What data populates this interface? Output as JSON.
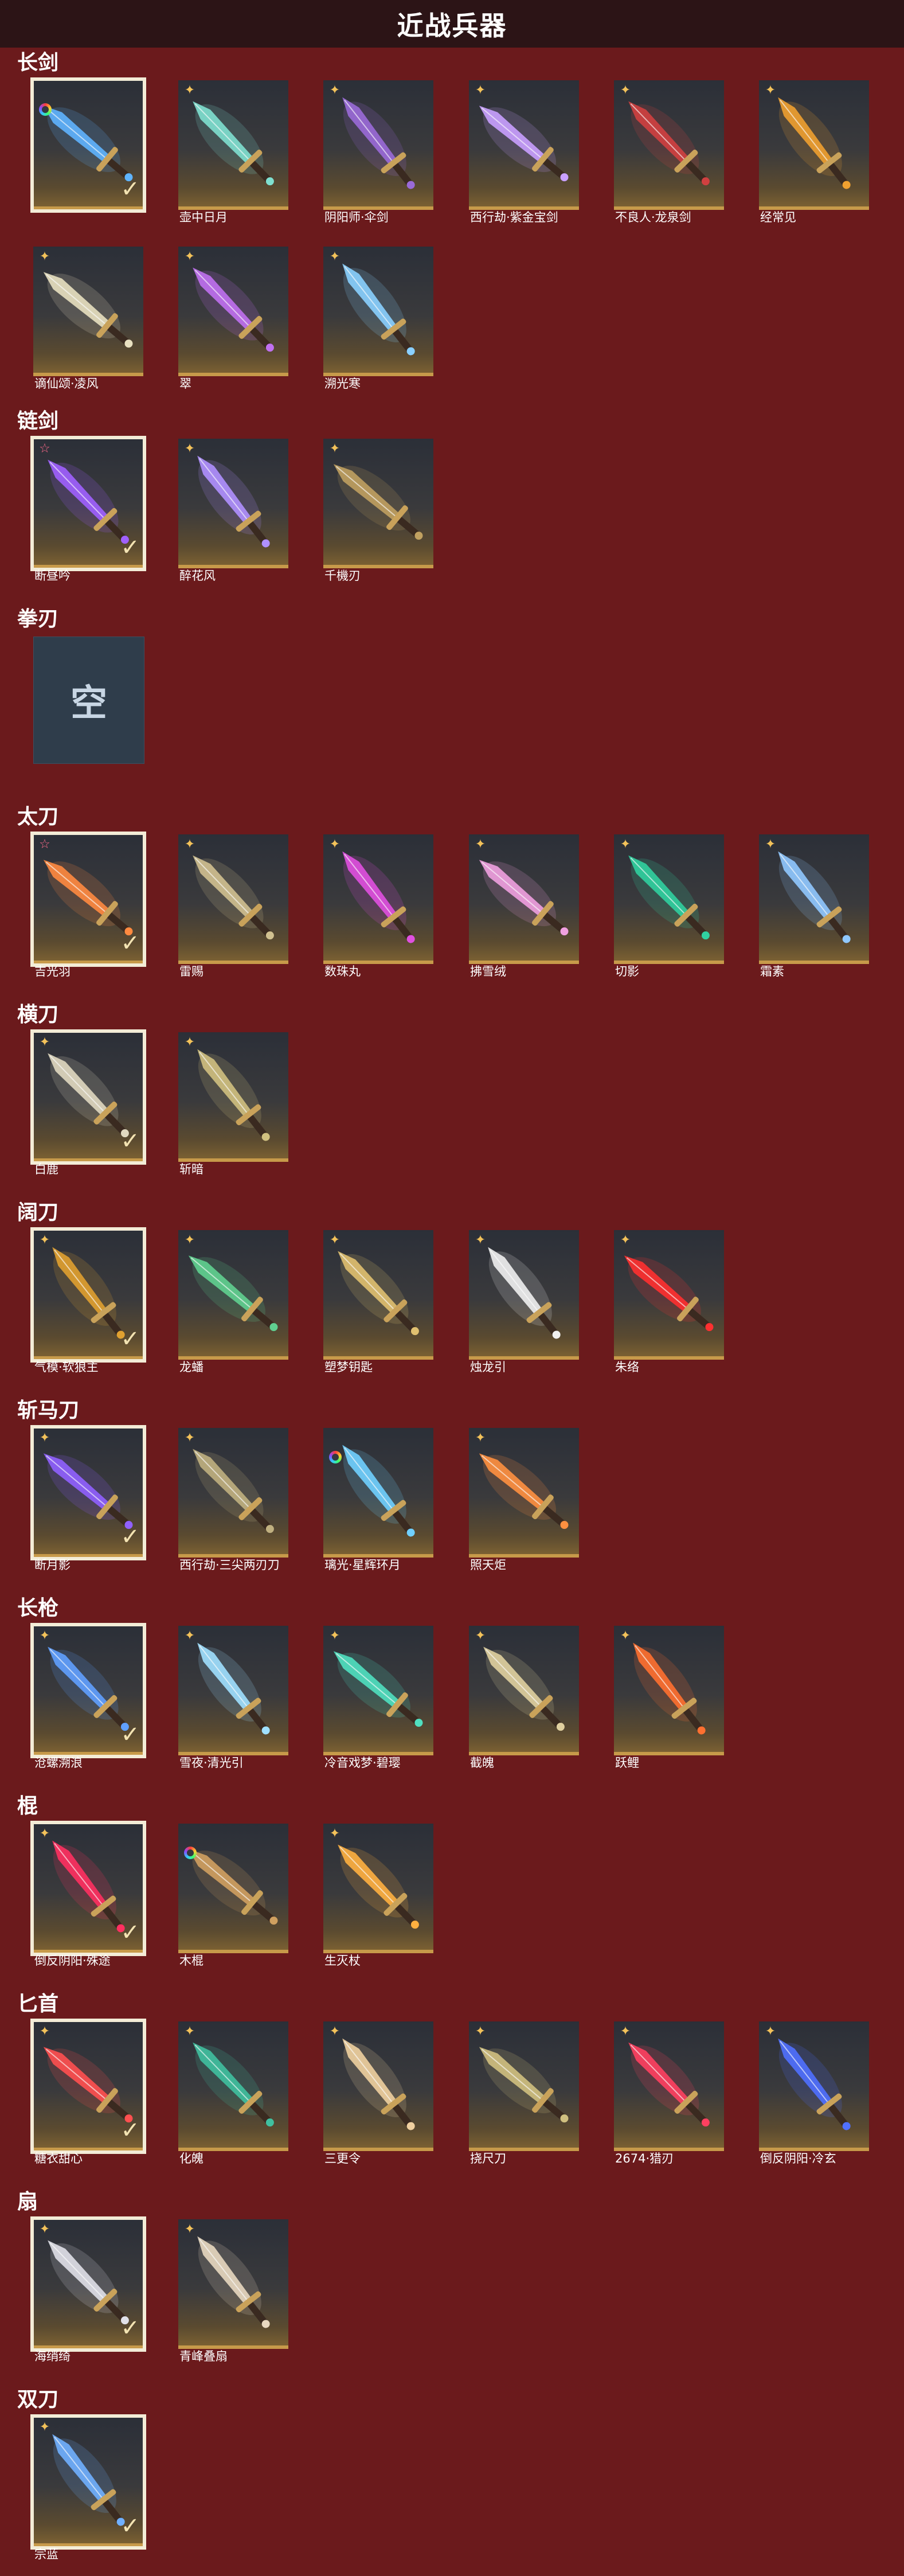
{
  "title": "近战兵器",
  "colors": {
    "background": "#6b1a1c",
    "titlebar": "#2c1416",
    "card_accent": "#c79a4a",
    "selected_border": "#f3ecd7"
  },
  "sections": [
    {
      "label": "长剑",
      "items": [
        {
          "name": "",
          "badge": "rainbow",
          "selected": true,
          "hue": "#5fb4ff"
        },
        {
          "name": "壶中日月",
          "badge": "gold",
          "selected": false,
          "hue": "#7fe0d0"
        },
        {
          "name": "阴阳师·伞剑",
          "badge": "gold",
          "selected": false,
          "hue": "#9a6ad8"
        },
        {
          "name": "西行劫·紫金宝剑",
          "badge": "gold",
          "selected": false,
          "hue": "#c9a0ff"
        },
        {
          "name": "不良人·龙泉剑",
          "badge": "gold",
          "selected": false,
          "hue": "#d04040"
        },
        {
          "name": "经常见",
          "badge": "gold",
          "selected": false,
          "hue": "#f0a030"
        },
        {
          "name": "谪仙颂·凌风",
          "badge": "gold",
          "selected": false,
          "hue": "#e8e0c0"
        },
        {
          "name": "翠",
          "badge": "gold",
          "selected": false,
          "hue": "#c070f0"
        },
        {
          "name": "溯光寒",
          "badge": "gold",
          "selected": false,
          "hue": "#8ad0ff"
        }
      ]
    },
    {
      "label": "链剑",
      "items": [
        {
          "name": "断昼吟",
          "badge": "pink",
          "selected": true,
          "hue": "#a060ff"
        },
        {
          "name": "醉花风",
          "badge": "gold",
          "selected": false,
          "hue": "#b090ff"
        },
        {
          "name": "千機刃",
          "badge": "gold",
          "selected": false,
          "hue": "#c0a060"
        }
      ]
    },
    {
      "label": "拳刃",
      "items": [
        {
          "name": "",
          "empty": true,
          "empty_text": "空"
        }
      ]
    },
    {
      "label": "太刀",
      "items": [
        {
          "name": "吉光羽",
          "badge": "pink",
          "selected": true,
          "hue": "#ff8a40"
        },
        {
          "name": "雷赐",
          "badge": "gold",
          "selected": false,
          "hue": "#d0c090"
        },
        {
          "name": "数珠丸",
          "badge": "gold",
          "selected": false,
          "hue": "#e050e0"
        },
        {
          "name": "拂雪绒",
          "badge": "gold",
          "selected": false,
          "hue": "#f0a0e0"
        },
        {
          "name": "切影",
          "badge": "gold",
          "selected": false,
          "hue": "#30d0a0"
        },
        {
          "name": "霜素",
          "badge": "gold",
          "selected": false,
          "hue": "#90c8ff"
        }
      ]
    },
    {
      "label": "横刀",
      "items": [
        {
          "name": "白鹿",
          "badge": "gold",
          "selected": true,
          "hue": "#e0d8c0"
        },
        {
          "name": "斩暗",
          "badge": "gold",
          "selected": false,
          "hue": "#d0c080"
        }
      ]
    },
    {
      "label": "阔刀",
      "items": [
        {
          "name": "气模·软狼主",
          "badge": "gold",
          "selected": true,
          "hue": "#e0a030"
        },
        {
          "name": "龙蟠",
          "badge": "gold",
          "selected": false,
          "hue": "#60d090"
        },
        {
          "name": "塑梦钥匙",
          "badge": "gold",
          "selected": false,
          "hue": "#e0c070"
        },
        {
          "name": "烛龙引",
          "badge": "gold",
          "selected": false,
          "hue": "#f0f0f0"
        },
        {
          "name": "朱络",
          "badge": "gold",
          "selected": false,
          "hue": "#ff3030"
        }
      ]
    },
    {
      "label": "斩马刀",
      "items": [
        {
          "name": "断月影",
          "badge": "gold",
          "selected": true,
          "hue": "#9060ff"
        },
        {
          "name": "西行劫·三尖两刃刀",
          "badge": "gold",
          "selected": false,
          "hue": "#c0b080"
        },
        {
          "name": "璃光·星辉环月",
          "badge": "rainbow",
          "selected": false,
          "hue": "#70d0ff"
        },
        {
          "name": "照天炬",
          "badge": "gold",
          "selected": false,
          "hue": "#ff9040"
        }
      ]
    },
    {
      "label": "长枪",
      "items": [
        {
          "name": "沧螺溯浪",
          "badge": "gold",
          "selected": true,
          "hue": "#60a0ff"
        },
        {
          "name": "雪夜·清光引",
          "badge": "gold",
          "selected": false,
          "hue": "#a0e0ff"
        },
        {
          "name": "冷音戏梦·碧璎",
          "badge": "gold",
          "selected": false,
          "hue": "#50e0c0"
        },
        {
          "name": "截魄",
          "badge": "gold",
          "selected": false,
          "hue": "#e0d0a0"
        },
        {
          "name": "跃鲤",
          "badge": "gold",
          "selected": false,
          "hue": "#ff7030"
        }
      ]
    },
    {
      "label": "棍",
      "items": [
        {
          "name": "倒反阴阳·殊途",
          "badge": "gold",
          "selected": true,
          "hue": "#ff3060"
        },
        {
          "name": "木棍",
          "badge": "rainbow",
          "selected": false,
          "hue": "#d0a060"
        },
        {
          "name": "生灭杖",
          "badge": "gold",
          "selected": false,
          "hue": "#ffb040"
        }
      ]
    },
    {
      "label": "匕首",
      "items": [
        {
          "name": "糖衣甜心",
          "badge": "gold",
          "selected": true,
          "hue": "#ff5050"
        },
        {
          "name": "化魄",
          "badge": "gold",
          "selected": false,
          "hue": "#40c0a0"
        },
        {
          "name": "三更令",
          "badge": "gold",
          "selected": false,
          "hue": "#f0d0a0"
        },
        {
          "name": "挠尺刀",
          "badge": "gold",
          "selected": false,
          "hue": "#d0c080"
        },
        {
          "name": "2674·猎刃",
          "badge": "gold",
          "selected": false,
          "hue": "#ff4060"
        },
        {
          "name": "倒反阴阳·冷玄",
          "badge": "gold",
          "selected": false,
          "hue": "#5070ff"
        }
      ]
    },
    {
      "label": "扇",
      "items": [
        {
          "name": "海绡绮",
          "badge": "gold",
          "selected": true,
          "hue": "#e0e0e8"
        },
        {
          "name": "青峰叠扇",
          "badge": "gold",
          "selected": false,
          "hue": "#e8d8c0"
        }
      ]
    },
    {
      "label": "双刀",
      "items": [
        {
          "name": "宗蓝",
          "badge": "gold",
          "selected": true,
          "hue": "#70b0ff"
        }
      ]
    }
  ]
}
